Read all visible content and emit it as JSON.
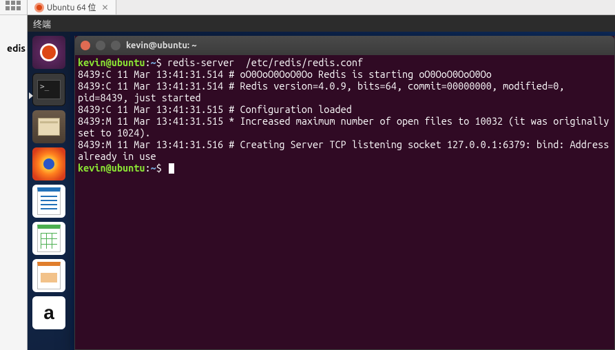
{
  "vm": {
    "tab_label": "Ubuntu 64 位",
    "close_glyph": "✕"
  },
  "gnome": {
    "top_bar_title": "终端"
  },
  "dock": {
    "items": [
      "ubuntu",
      "terminal",
      "files",
      "firefox",
      "writer",
      "calc",
      "impress",
      "amazon"
    ],
    "amazon_glyph": "a"
  },
  "terminal": {
    "title": "kevin@ubuntu: ~",
    "prompt_user": "kevin@ubuntu",
    "prompt_path": "~",
    "prompt_symbol": "$",
    "command": "redis-server  /etc/redis/redis.conf",
    "lines": [
      "8439:C 11 Mar 13:41:31.514 # oO0OoO0OoO0Oo Redis is starting oO0OoO0OoO0Oo",
      "8439:C 11 Mar 13:41:31.514 # Redis version=4.0.9, bits=64, commit=00000000, modified=0, pid=8439, just started",
      "8439:C 11 Mar 13:41:31.515 # Configuration loaded",
      "8439:M 11 Mar 13:41:31.515 * Increased maximum number of open files to 10032 (it was originally set to 1024).",
      "8439:M 11 Mar 13:41:31.516 # Creating Server TCP listening socket 127.0.0.1:6379: bind: Address already in use"
    ]
  },
  "sidebar": {
    "partial_text": "edis"
  }
}
